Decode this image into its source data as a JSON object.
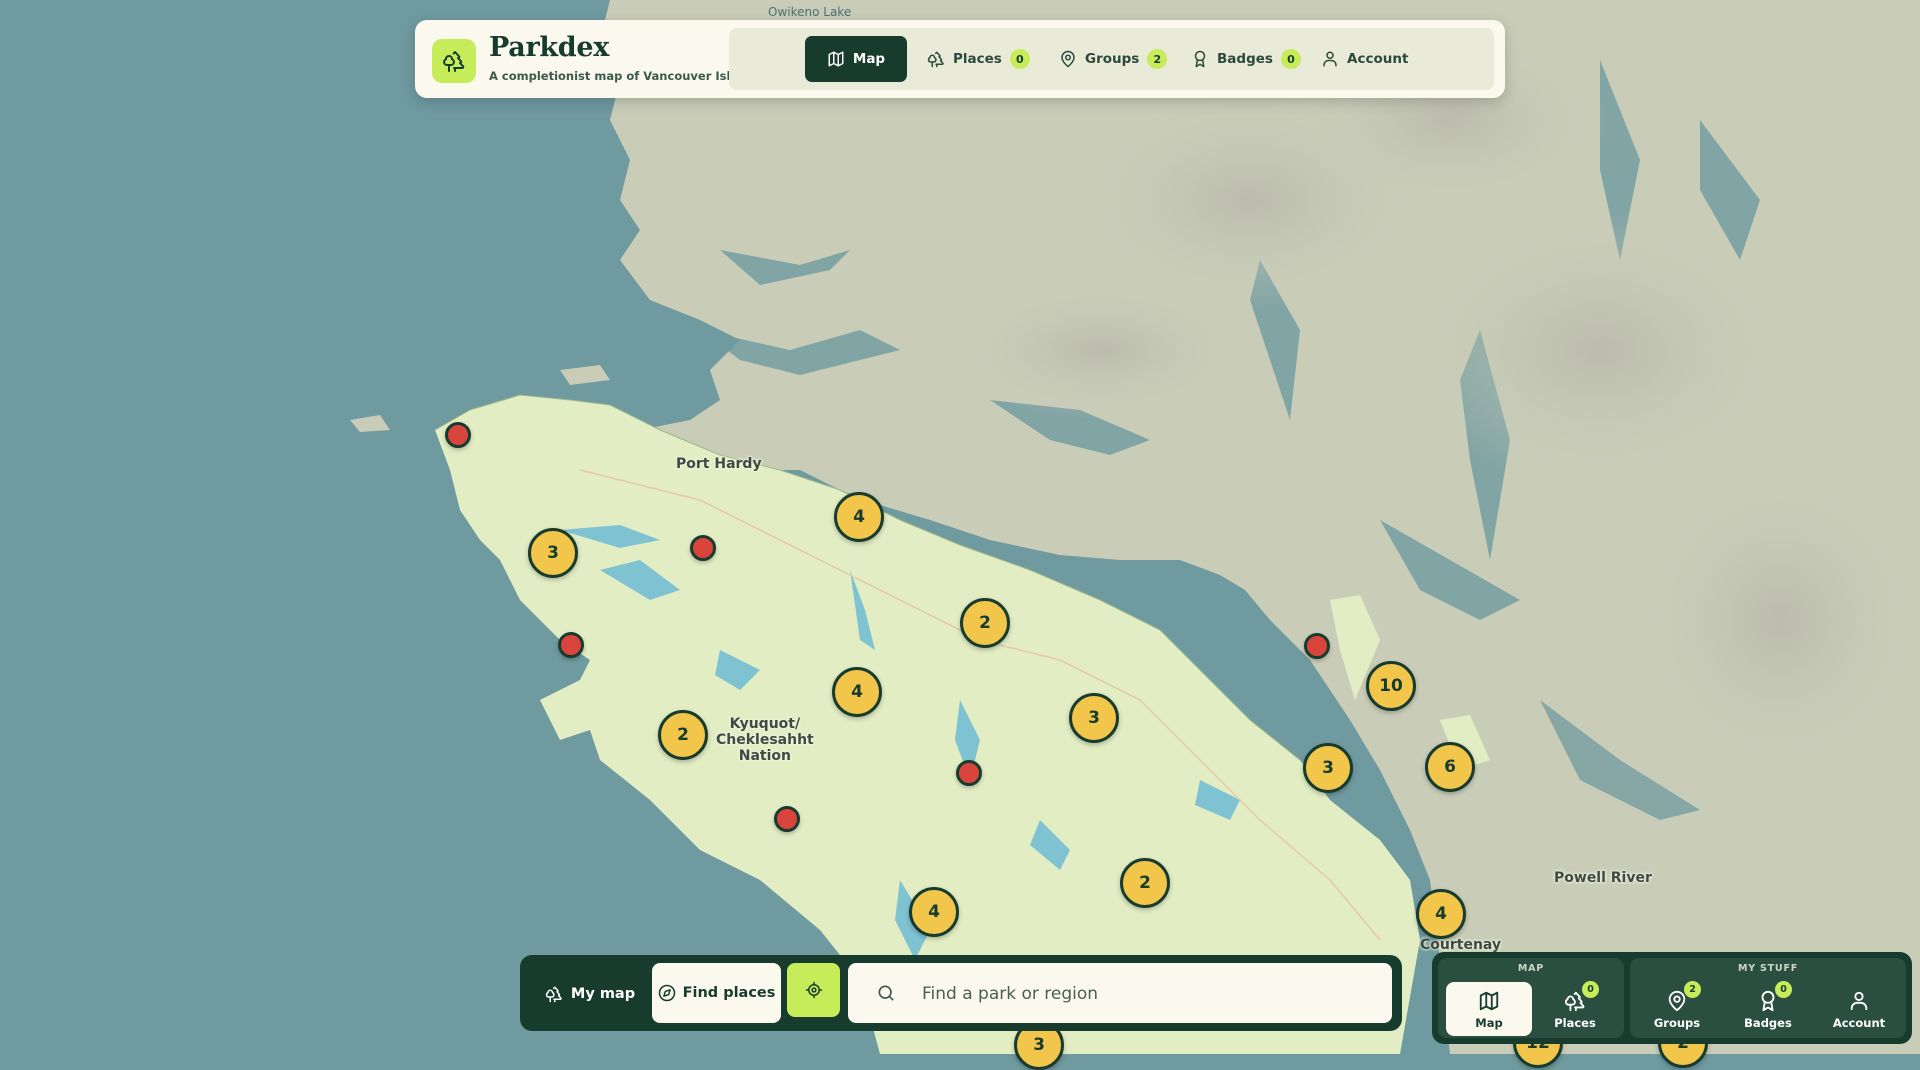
{
  "app": {
    "title": "Parkdex",
    "subtitle": "A completionist map of Vancouver Island"
  },
  "nav": {
    "items": [
      {
        "label": "Map",
        "icon": "map-icon",
        "active": true
      },
      {
        "label": "Places",
        "icon": "trees-icon",
        "count": "0"
      },
      {
        "label": "Groups",
        "icon": "map-pin-icon",
        "count": "2"
      },
      {
        "label": "Badges",
        "icon": "badge-icon",
        "count": "0"
      },
      {
        "label": "Account",
        "icon": "user-icon"
      }
    ]
  },
  "map": {
    "labels": {
      "owikeno": "Owikeno Lake",
      "port_hardy": "Port Hardy",
      "kyuquot": "Kyuquot/\nCheklesahht\nNation",
      "powell_river": "Powell River",
      "courtenay": "Courtenay"
    },
    "clusters": [
      {
        "id": "c1",
        "count": "4"
      },
      {
        "id": "c2",
        "count": "3"
      },
      {
        "id": "c3",
        "count": "2"
      },
      {
        "id": "c4",
        "count": "4"
      },
      {
        "id": "c5",
        "count": "2"
      },
      {
        "id": "c6",
        "count": "3"
      },
      {
        "id": "c7",
        "count": "10"
      },
      {
        "id": "c8",
        "count": "3"
      },
      {
        "id": "c9",
        "count": "6"
      },
      {
        "id": "c10",
        "count": "2"
      },
      {
        "id": "c11",
        "count": "4"
      },
      {
        "id": "c12",
        "count": "4"
      },
      {
        "id": "c13",
        "count": "3"
      },
      {
        "id": "c14",
        "count": "12"
      },
      {
        "id": "c15",
        "count": "2"
      }
    ],
    "colors": {
      "water": "#6f9aa0",
      "island": "#e2edc4",
      "mainland": "#c9cdb8",
      "cluster": "#f2c54b",
      "pin": "#d9443c",
      "accent": "#c6ec5a",
      "dark": "#173c2e"
    }
  },
  "toolbar": {
    "my_map": "My map",
    "find_places": "Find places",
    "locate_icon": "crosshair-icon",
    "search_placeholder": "Find a park or region"
  },
  "dock": {
    "map_heading": "MAP",
    "stuff_heading": "MY STUFF",
    "items": [
      {
        "label": "Map",
        "icon": "map-icon",
        "active": true
      },
      {
        "label": "Places",
        "icon": "trees-icon",
        "count": "0"
      },
      {
        "label": "Groups",
        "icon": "map-pin-icon",
        "count": "2"
      },
      {
        "label": "Badges",
        "icon": "badge-icon",
        "count": "0"
      },
      {
        "label": "Account",
        "icon": "user-icon"
      }
    ]
  }
}
